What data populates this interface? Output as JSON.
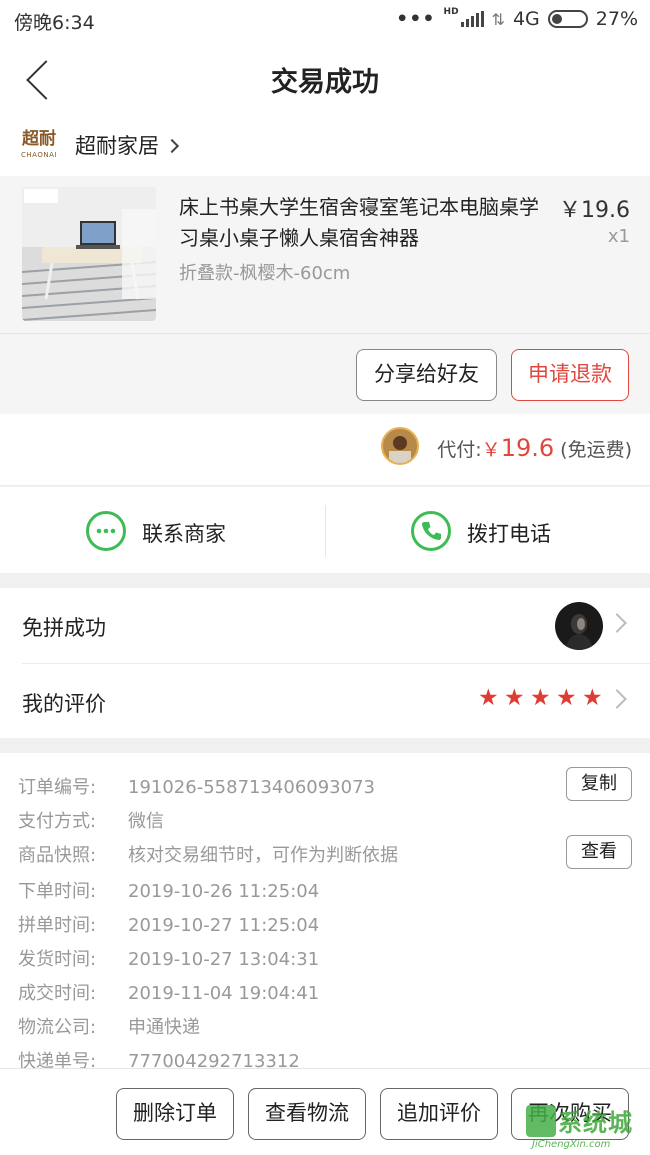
{
  "status": {
    "time": "傍晚6:34",
    "dots": "•••",
    "hd": "HD",
    "net": "4G",
    "battery": "27%"
  },
  "nav": {
    "title": "交易成功"
  },
  "shop": {
    "logo_cn": "超耐",
    "logo_en": "CHAONAI",
    "name": "超耐家居"
  },
  "product": {
    "title": "床上书桌大学生宿舍寝室笔记本电脑桌学习桌小桌子懒人桌宿舍神器",
    "spec": "折叠款-枫樱木-60cm",
    "price": "￥19.6",
    "qty": "x1",
    "share_label": "分享给好友",
    "refund_label": "申请退款"
  },
  "payment": {
    "prefix": "代付:",
    "yen": "￥",
    "amount": "19.6",
    "suffix": "(免运费)"
  },
  "contact": {
    "merchant_label": "联系商家",
    "phone_label": "拨打电话",
    "icon_color": "#3dbb55"
  },
  "rows": {
    "group_label": "免拼成功",
    "review_label": "我的评价",
    "stars": "★★★★★",
    "rating": 5
  },
  "order": {
    "items": [
      {
        "key": "订单编号:",
        "value": "191026-558713406093073"
      },
      {
        "key": "支付方式:",
        "value": "微信"
      },
      {
        "key": "商品快照:",
        "value": "核对交易细节时，可作为判断依据"
      },
      {
        "key": "下单时间:",
        "value": "2019-10-26 11:25:04"
      },
      {
        "key": "拼单时间:",
        "value": "2019-10-27 11:25:04"
      },
      {
        "key": "发货时间:",
        "value": "2019-10-27 13:04:31"
      },
      {
        "key": "成交时间:",
        "value": "2019-11-04 19:04:41"
      },
      {
        "key": "物流公司:",
        "value": "申通快递"
      },
      {
        "key": "快递单号:",
        "value": "777004292713312"
      }
    ],
    "copy_label": "复制",
    "view_label": "查看"
  },
  "bottom": {
    "delete_label": "删除订单",
    "logistics_label": "查看物流",
    "add_review_label": "追加评价",
    "rebuy_label": "再次购买"
  },
  "watermark": {
    "cn": "系统城",
    "en": "JiChengXin.com"
  },
  "colors": {
    "accent_red": "#e0483f",
    "green": "#3dbb55"
  }
}
